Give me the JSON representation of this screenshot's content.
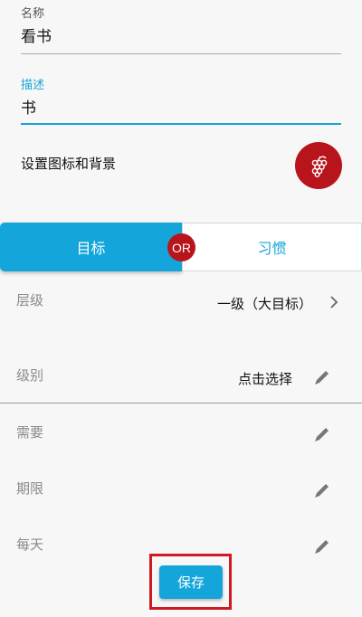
{
  "form": {
    "name_label": "名称",
    "name_value": "看书",
    "desc_label": "描述",
    "desc_value": "书"
  },
  "icon_setting": {
    "label": "设置图标和背景",
    "icon": "grapes-icon",
    "bg_color": "#b8141b"
  },
  "tabs": {
    "goal": "目标",
    "or": "OR",
    "habit": "习惯"
  },
  "rows": {
    "level_label": "层级",
    "level_value": "一级（大目标）",
    "grade_label": "级别",
    "grade_value": "点击选择",
    "need_label": "需要",
    "deadline_label": "期限",
    "daily_label": "每天"
  },
  "actions": {
    "save_label": "保存"
  },
  "colors": {
    "accent": "#14a6da",
    "badge": "#b8141b",
    "highlight": "#d11a20"
  }
}
